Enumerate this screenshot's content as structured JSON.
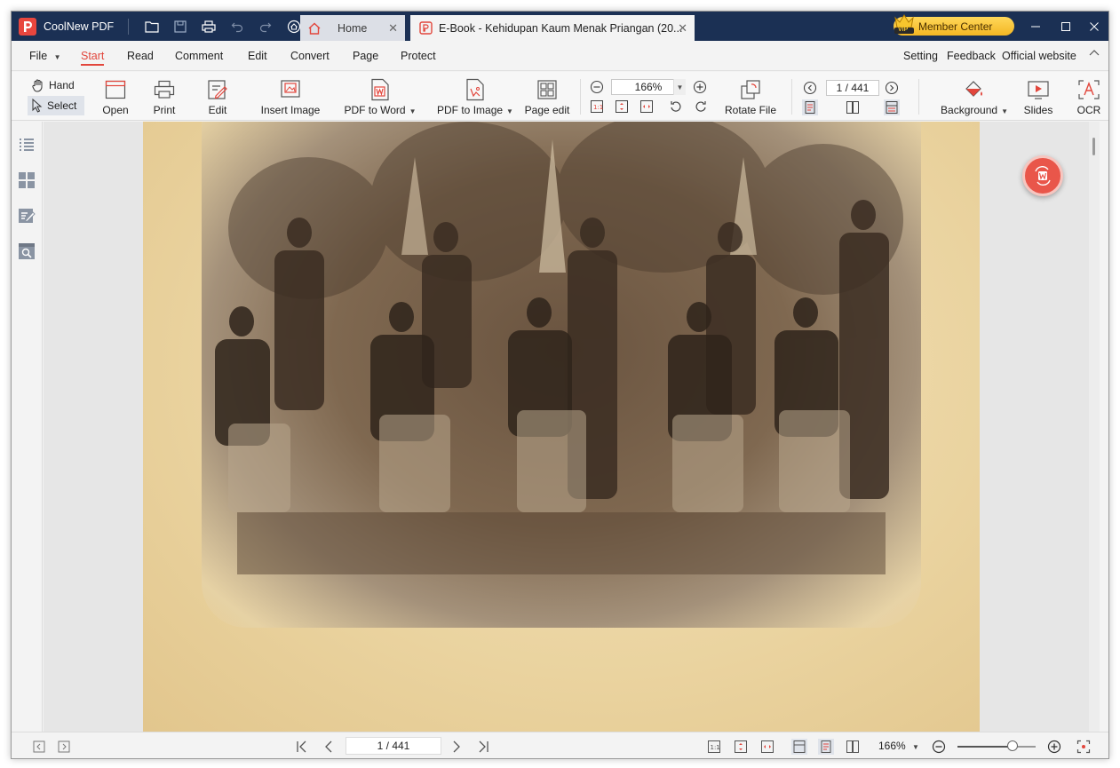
{
  "app": {
    "name": "CoolNew PDF"
  },
  "tabs": [
    {
      "title": "Home"
    },
    {
      "title": "E-Book - Kehidupan Kaum Menak Priangan (20..."
    }
  ],
  "member_center": "Member Center",
  "vip_label": "VIP",
  "menu": {
    "file": "File",
    "items": [
      "Start",
      "Read",
      "Comment",
      "Edit",
      "Convert",
      "Page",
      "Protect"
    ],
    "active": "Start",
    "right": [
      "Setting",
      "Feedback",
      "Official website"
    ]
  },
  "ribbon": {
    "hand": "Hand",
    "select": "Select",
    "open": "Open",
    "print": "Print",
    "edit": "Edit",
    "insert_image": "Insert Image",
    "pdf_to_word": "PDF to Word",
    "pdf_to_image": "PDF to Image",
    "page_edit": "Page edit",
    "zoom_value": "166%",
    "rotate_file": "Rotate File",
    "page_indicator": "1 / 441",
    "background": "Background",
    "slides": "Slides",
    "ocr": "OCR"
  },
  "status": {
    "page_indicator": "1 / 441",
    "zoom_value": "166%",
    "zoom_slider_fraction": 0.7
  },
  "colors": {
    "titlebar": "#1b3054",
    "accent": "#e2463c",
    "member_gold": "#f3b623"
  }
}
